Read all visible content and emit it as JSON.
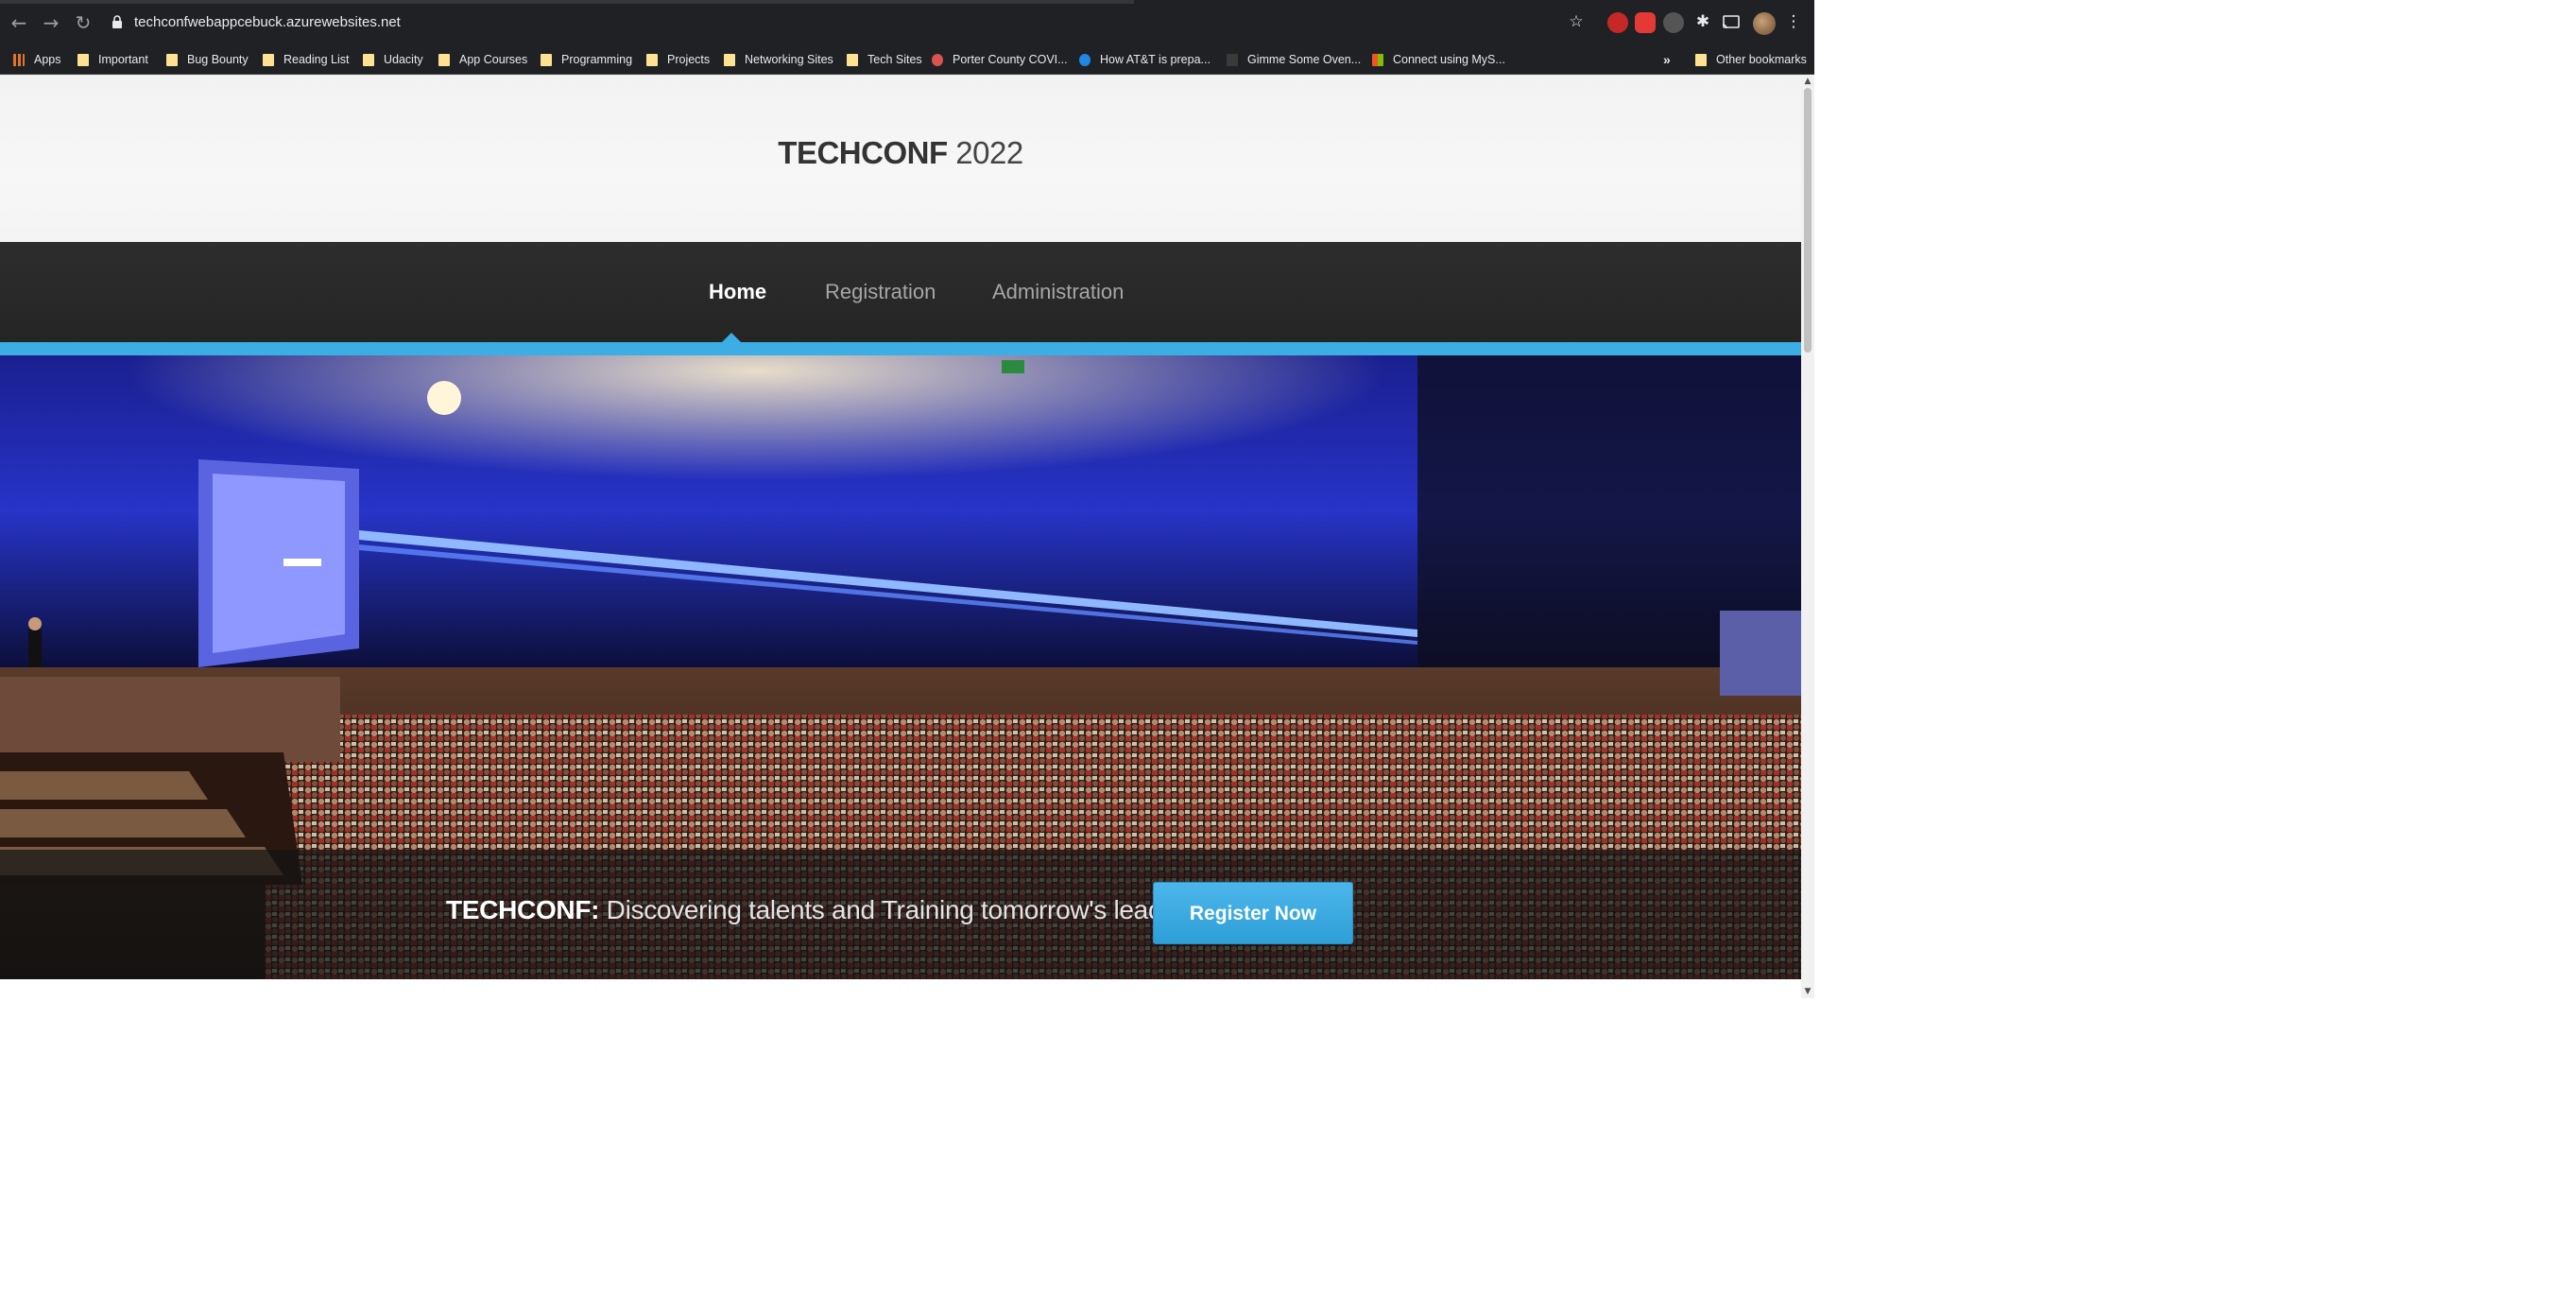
{
  "browser": {
    "url": "techconfwebappcebuck.azurewebsites.net",
    "icons": [
      "back-icon",
      "forward-icon",
      "reload-icon",
      "lock-icon",
      "star-icon",
      "extension-icon",
      "cast-icon",
      "profile-avatar",
      "menu-icon"
    ],
    "bookmarks": [
      {
        "label": "Apps",
        "icon": "apps-grid-icon"
      },
      {
        "label": "Important",
        "icon": "folder-icon"
      },
      {
        "label": "Bug Bounty",
        "icon": "folder-icon"
      },
      {
        "label": "Reading List",
        "icon": "folder-icon"
      },
      {
        "label": "Udacity",
        "icon": "folder-icon"
      },
      {
        "label": "App Courses",
        "icon": "folder-icon"
      },
      {
        "label": "Programming",
        "icon": "folder-icon"
      },
      {
        "label": "Projects",
        "icon": "folder-icon"
      },
      {
        "label": "Networking Sites",
        "icon": "folder-icon"
      },
      {
        "label": "Tech Sites",
        "icon": "folder-icon"
      },
      {
        "label": "Porter County COVI...",
        "icon": "site-icon"
      },
      {
        "label": "How AT&T is prepa...",
        "icon": "globe-icon"
      },
      {
        "label": "Gimme Some Oven...",
        "icon": "site-icon"
      },
      {
        "label": "Connect using MyS...",
        "icon": "windows-icon"
      }
    ],
    "more_bookmarks": "»",
    "other_bookmarks": "Other bookmarks"
  },
  "site": {
    "logo_bold": "TECHCONF",
    "logo_year": "2022",
    "nav": [
      {
        "label": "Home",
        "active": true
      },
      {
        "label": "Registration",
        "active": false
      },
      {
        "label": "Administration",
        "active": false
      }
    ],
    "banner_bold": "TECHCONF:",
    "banner_text": "Discovering talents and Training tomorrow's leaders",
    "register_button": "Register Now"
  },
  "colors": {
    "accent": "#3daee4",
    "nav_bg": "#2a2a2a",
    "header_bg": "#f4f4f4",
    "browser_chrome": "#202124"
  }
}
